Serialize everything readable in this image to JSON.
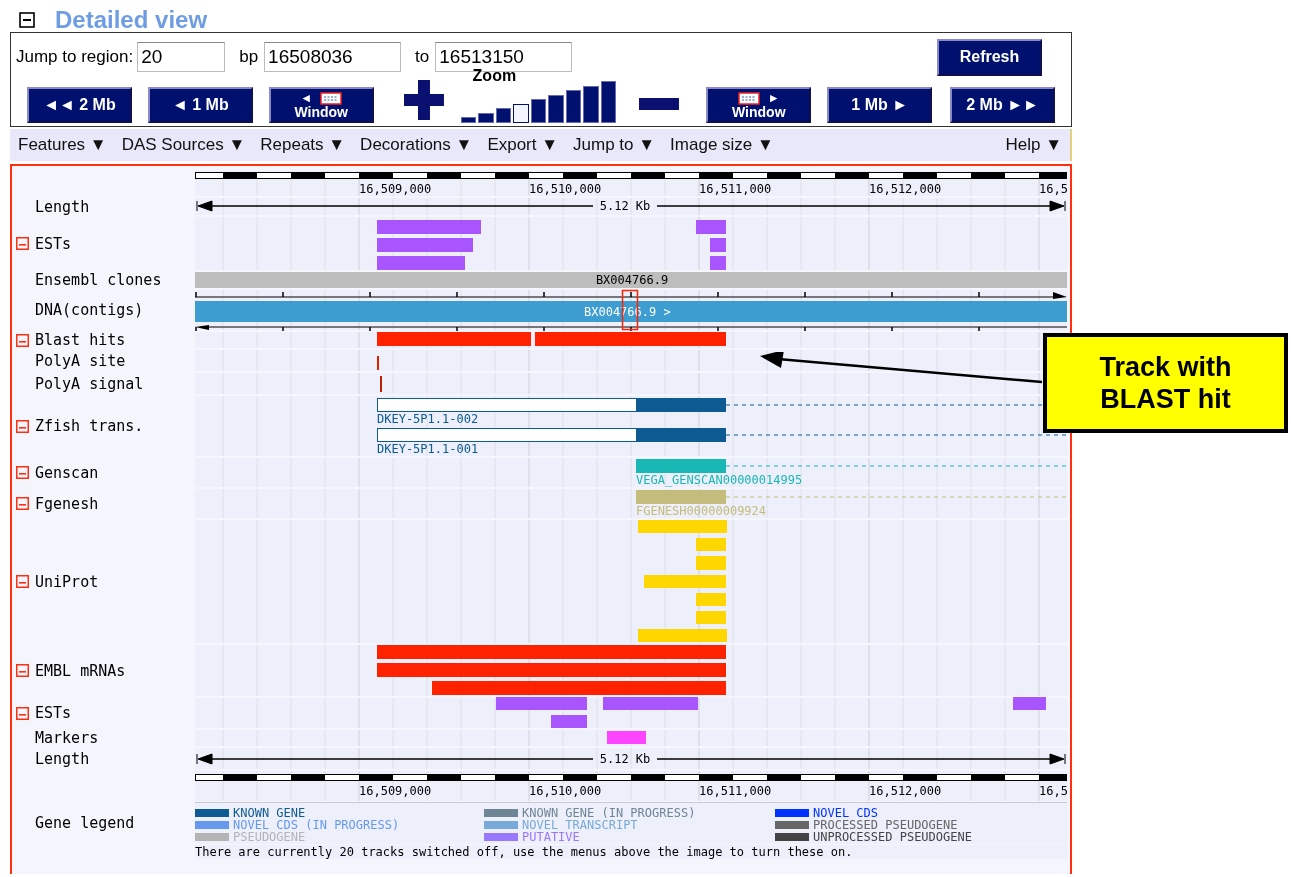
{
  "header": {
    "title": "Detailed view",
    "collapsible": true
  },
  "jump": {
    "label": "Jump to region:",
    "region": "20",
    "bp_label": "bp",
    "start": "16508036",
    "to_label": "to",
    "end": "16513150",
    "refresh": "Refresh"
  },
  "nav": [
    {
      "kind": "step",
      "label": "◄◄ 2 Mb"
    },
    {
      "kind": "step",
      "label": "◄ 1 Mb"
    },
    {
      "kind": "window",
      "arrow": "◄",
      "label": "Window",
      "icon_first": false
    },
    {
      "kind": "zoom_in"
    },
    {
      "kind": "zoom",
      "label": "Zoom",
      "levels": [
        {
          "selected": false
        },
        {
          "selected": false
        },
        {
          "selected": false
        },
        {
          "selected": true
        },
        {
          "selected": false
        },
        {
          "selected": false
        },
        {
          "selected": false
        },
        {
          "selected": false
        },
        {
          "selected": false
        }
      ]
    },
    {
      "kind": "zoom_out"
    },
    {
      "kind": "window",
      "arrow": "►",
      "label": "Window",
      "icon_first": true
    },
    {
      "kind": "step",
      "label": "1 Mb ►"
    },
    {
      "kind": "step",
      "label": "2 Mb ►►"
    }
  ],
  "menu": {
    "items": [
      "Features ▼",
      "DAS Sources ▼",
      "Repeats ▼",
      "Decorations ▼",
      "Export ▼",
      "Jump to ▼",
      "Image size ▼"
    ],
    "help": "Help ▼"
  },
  "tracks": [
    {
      "kind": "ruler",
      "ticks": [
        "16,509,000",
        "16,510,000",
        "16,511,000",
        "16,512,000",
        "16,5"
      ]
    },
    {
      "kind": "length",
      "label": "Length",
      "collapsible": false,
      "reading": "5.12 Kb"
    },
    {
      "kind": "features",
      "label": "ESTs",
      "collapsible": true
    },
    {
      "kind": "clone",
      "label": "Ensembl clones",
      "collapsible": false,
      "feature_label": "BX004766.9"
    },
    {
      "kind": "contig",
      "label": "DNA(contigs)",
      "collapsible": false,
      "feature_label": "BX004766.9 >"
    },
    {
      "kind": "features",
      "label": "Blast hits",
      "collapsible": true
    },
    {
      "kind": "features",
      "label": "PolyA site",
      "collapsible": false
    },
    {
      "kind": "features",
      "label": "PolyA signal",
      "collapsible": false
    },
    {
      "kind": "transcripts",
      "label": "Zfish trans.",
      "collapsible": true,
      "feature_labels": [
        "DKEY-5P1.1-002",
        "DKEY-5P1.1-001"
      ]
    },
    {
      "kind": "transcripts",
      "label": "Genscan",
      "collapsible": true,
      "feature_labels": [
        "VEGA_GENSCAN00000014995"
      ]
    },
    {
      "kind": "transcripts",
      "label": "Fgenesh",
      "collapsible": true,
      "feature_labels": [
        "FGENESH00000009924"
      ]
    },
    {
      "kind": "features",
      "label": "UniProt",
      "collapsible": true
    },
    {
      "kind": "features",
      "label": "EMBL mRNAs",
      "collapsible": true
    },
    {
      "kind": "features",
      "label": "ESTs",
      "collapsible": true
    },
    {
      "kind": "features",
      "label": "Markers",
      "collapsible": false
    },
    {
      "kind": "length",
      "label": "Length",
      "collapsible": false,
      "reading": "5.12 Kb"
    },
    {
      "kind": "ruler",
      "ticks": [
        "16,509,000",
        "16,510,000",
        "16,511,000",
        "16,512,000",
        "16,5"
      ]
    },
    {
      "kind": "legend",
      "label": "Gene legend",
      "collapsible": false,
      "entries": [
        {
          "label": "KNOWN GENE",
          "color": "#0e5a92"
        },
        {
          "label": "KNOWN GENE (IN PROGRESS)",
          "color": "#6e8595"
        },
        {
          "label": "NOVEL CDS",
          "color": "#0033ff"
        },
        {
          "label": "NOVEL CDS (IN PROGRESS)",
          "color": "#6699ee"
        },
        {
          "label": "NOVEL TRANSCRIPT",
          "color": "#77aad8"
        },
        {
          "label": "PROCESSED PSEUDOGENE",
          "color": "#666666"
        },
        {
          "label": "PSEUDOGENE",
          "color": "#b4b4b4"
        },
        {
          "label": "PUTATIVE",
          "color": "#9977ff"
        },
        {
          "label": "UNPROCESSED PSEUDOGENE",
          "color": "#444444"
        }
      ]
    }
  ],
  "note": "There are currently 20 tracks switched off, use the menus above the image to turn these on.",
  "callout": {
    "text": "Track with BLAST hit"
  }
}
